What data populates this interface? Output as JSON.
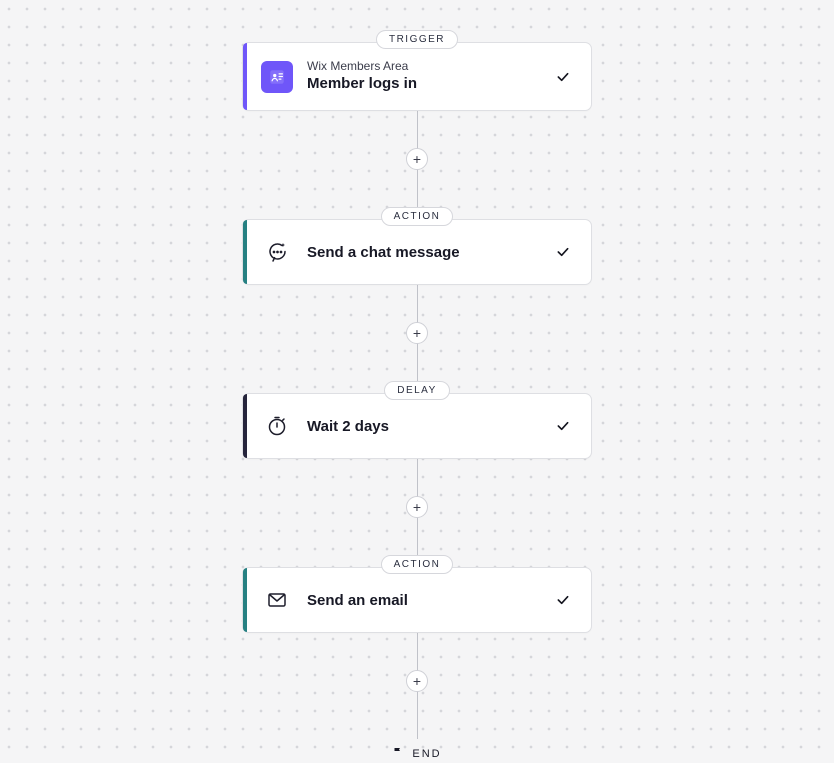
{
  "flow": {
    "steps": [
      {
        "badge": "TRIGGER",
        "accent": "accent-purple",
        "icon": "app-members",
        "subtitle": "Wix Members Area",
        "title": "Member logs in",
        "completed": true
      },
      {
        "badge": "ACTION",
        "accent": "accent-teal",
        "icon": "chat",
        "subtitle": "",
        "title": "Send a chat message",
        "completed": true
      },
      {
        "badge": "DELAY",
        "accent": "accent-dark",
        "icon": "stopwatch",
        "subtitle": "",
        "title": "Wait 2 days",
        "completed": true
      },
      {
        "badge": "ACTION",
        "accent": "accent-teal",
        "icon": "email",
        "subtitle": "",
        "title": "Send an email",
        "completed": true
      }
    ],
    "end_label": "END",
    "add_label": "+"
  }
}
